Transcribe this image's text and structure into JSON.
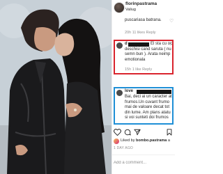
{
  "post": {
    "username": "florinpastrama",
    "location": "Valiug"
  },
  "comments": {
    "top_fragment": "puscariasa batrana.",
    "top_meta": "20h   11 likes   Reply",
    "red": {
      "username": "d",
      "lines": [
        "El sta cu oc",
        "deschisi cand saruta ( nu",
        "semn bun ). Arata neimp",
        "emotionala"
      ],
      "meta": "15h   1 like   Reply"
    },
    "blue": {
      "username": "love",
      "lines": [
        "Bai, deci ai un caracter at",
        "frumos.Un cuvant frumo",
        "mai de valoare decat tot",
        "din lume. Am plans atatu",
        "si voi sunteti doi frumos"
      ]
    }
  },
  "actions": {
    "icons": [
      "heart-icon",
      "comment-icon",
      "share-icon",
      "bookmark-icon"
    ]
  },
  "likes": {
    "prefix": "Liked by ",
    "by": "bombo.pastrama",
    "suffix": " a"
  },
  "timestamp": "1 DAY AGO",
  "add_comment": {
    "placeholder": "Add a comment..."
  },
  "colors": {
    "red_frame": "#d9232d",
    "blue_frame": "#1e8fd6"
  }
}
